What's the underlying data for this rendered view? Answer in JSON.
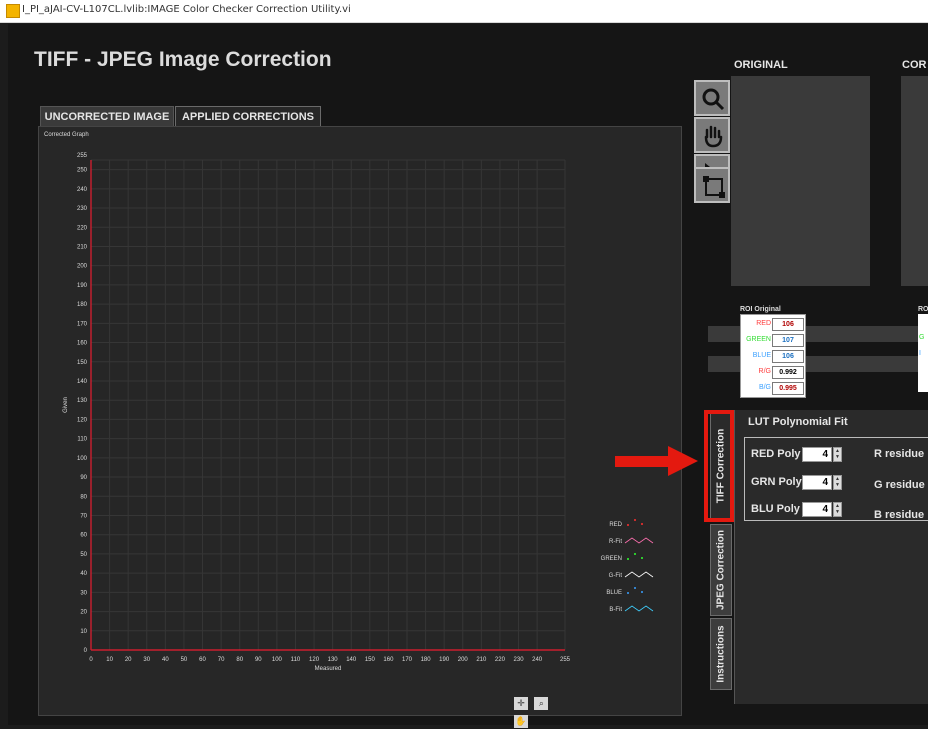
{
  "window": {
    "title": "I_PI_aJAI-CV-L107CL.lvlib:IMAGE Color Checker Correction Utility.vi"
  },
  "app": {
    "title": "TIFF - JPEG Image Correction"
  },
  "tabs": [
    {
      "label": "UNCORRECTED IMAGE"
    },
    {
      "label": "APPLIED CORRECTIONS"
    }
  ],
  "graph": {
    "caption": "Corrected Graph"
  },
  "chart_data": {
    "type": "scatter",
    "xlabel": "Measured",
    "ylabel": "Given",
    "xlim": [
      0,
      255
    ],
    "ylim": [
      0,
      255
    ],
    "x_ticks": [
      0,
      10,
      20,
      30,
      40,
      50,
      60,
      70,
      80,
      90,
      100,
      110,
      120,
      130,
      140,
      150,
      160,
      170,
      180,
      190,
      200,
      210,
      220,
      230,
      240,
      255
    ],
    "y_ticks": [
      0,
      10,
      20,
      30,
      40,
      50,
      60,
      70,
      80,
      90,
      100,
      110,
      120,
      130,
      140,
      150,
      160,
      170,
      180,
      190,
      200,
      210,
      220,
      230,
      240,
      250,
      255
    ],
    "grid": true,
    "legend_position": "bottom-right",
    "series": [
      {
        "name": "RED",
        "marker": "dot",
        "color": "#ff3030",
        "x": [],
        "y": []
      },
      {
        "name": "R-Fit",
        "marker": "line",
        "color": "#ff70b0",
        "x": [],
        "y": []
      },
      {
        "name": "GREEN",
        "marker": "dot",
        "color": "#30ff30",
        "x": [],
        "y": []
      },
      {
        "name": "G-Fit",
        "marker": "line",
        "color": "#ffffff",
        "x": [],
        "y": []
      },
      {
        "name": "BLUE",
        "marker": "dot",
        "color": "#3aa0ff",
        "x": [],
        "y": []
      },
      {
        "name": "B-Fit",
        "marker": "line",
        "color": "#3fd0ff",
        "x": [],
        "y": []
      }
    ]
  },
  "images": {
    "original_label": "ORIGINAL",
    "corrected_label": "COR"
  },
  "roi_original": {
    "title": "ROI Original",
    "rows": [
      {
        "name": "RED",
        "value": "106",
        "name_color": "#ff3b3b",
        "value_color": "#b00000"
      },
      {
        "name": "GREEN",
        "value": "107",
        "name_color": "#33dd33",
        "value_color": "#1a6fc0"
      },
      {
        "name": "BLUE",
        "value": "106",
        "name_color": "#3aa0ff",
        "value_color": "#1a6fc0"
      },
      {
        "name": "R/G",
        "value": "0.992",
        "name_color": "#ff3b3b",
        "value_color": "#000000"
      },
      {
        "name": "B/G",
        "value": "0.995",
        "name_color": "#3aa0ff",
        "value_color": "#b00000"
      }
    ]
  },
  "roi_corrected": {
    "title": "RO",
    "row_initials": [
      "G",
      "I"
    ]
  },
  "side_tabs": [
    {
      "label": "TIFF Correction"
    },
    {
      "label": "JPEG Correction"
    },
    {
      "label": "Instructions"
    }
  ],
  "lut": {
    "title": "LUT Polynomial Fit",
    "polys": [
      {
        "label": "RED Poly",
        "value": "4",
        "residue": "R residue"
      },
      {
        "label": "GRN Poly",
        "value": "4",
        "residue": "G residue"
      },
      {
        "label": "BLU Poly",
        "value": "4",
        "residue": "B residue"
      }
    ]
  },
  "icons": [
    "zoom-icon",
    "pan-hand-icon",
    "pointer-arrow-icon",
    "roi-rectangle-icon"
  ],
  "accent": {
    "annotation_red": "#e4190f",
    "axis_red": "#cc1f2f"
  }
}
